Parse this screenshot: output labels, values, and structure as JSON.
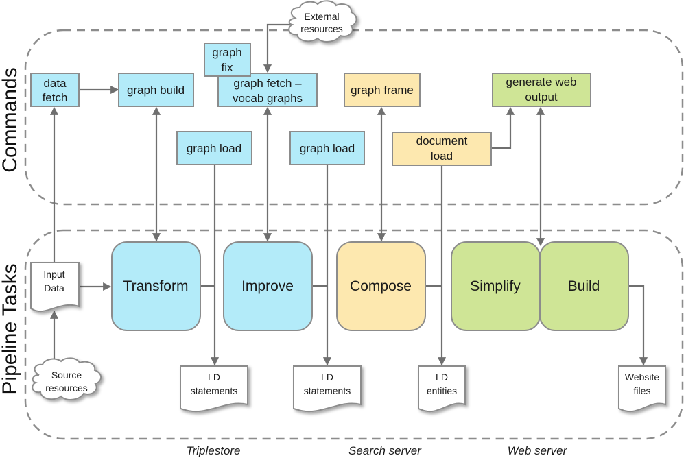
{
  "colors": {
    "blue": "#b3ebf9",
    "yellow": "#fde8af",
    "green": "#cfe596",
    "white": "#ffffff",
    "line": "#6f6f6f",
    "border": "#8c8c8c"
  },
  "sections": {
    "commands": "Commands",
    "pipeline": "Pipeline Tasks"
  },
  "clouds": {
    "external": [
      "External",
      "resources"
    ],
    "source": [
      "Source",
      "resources"
    ]
  },
  "commands": {
    "data_fetch": [
      "data",
      "fetch"
    ],
    "graph_build": [
      "graph build"
    ],
    "graph_fix": [
      "graph",
      "fix"
    ],
    "graph_fetch": [
      "graph fetch –",
      "vocab graphs"
    ],
    "graph_load_1": [
      "graph load"
    ],
    "graph_load_2": [
      "graph load"
    ],
    "graph_frame": [
      "graph frame"
    ],
    "document_load": [
      "document",
      "load"
    ],
    "generate_web_output": [
      "generate web",
      "output"
    ]
  },
  "tasks": {
    "transform": "Transform",
    "improve": "Improve",
    "compose": "Compose",
    "simplify": "Simplify",
    "build": "Build"
  },
  "documents": {
    "input_data": [
      "Input",
      "Data"
    ],
    "ld_statements_1": [
      "LD",
      "statements"
    ],
    "ld_statements_2": [
      "LD",
      "statements"
    ],
    "ld_entities": [
      "LD",
      "entities"
    ],
    "website_files": [
      "Website",
      "files"
    ]
  },
  "servers": {
    "triplestore": "Triplestore",
    "search_server": "Search server",
    "web_server": "Web server"
  }
}
